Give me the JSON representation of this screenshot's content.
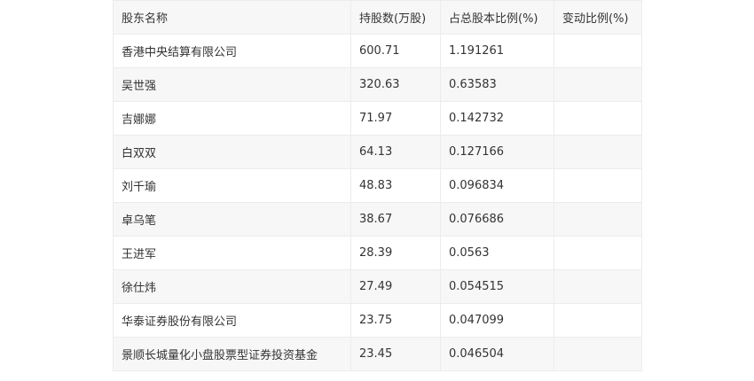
{
  "table": {
    "headers": [
      "股东名称",
      "持股数(万股)",
      "占总股本比例(%)",
      "变动比例(%)"
    ],
    "rows": [
      [
        "香港中央结算有限公司",
        "600.71",
        "1.191261",
        ""
      ],
      [
        "吴世强",
        "320.63",
        "0.63583",
        ""
      ],
      [
        "吉娜娜",
        "71.97",
        "0.142732",
        ""
      ],
      [
        "白双双",
        "64.13",
        "0.127166",
        ""
      ],
      [
        "刘千瑜",
        "48.83",
        "0.096834",
        ""
      ],
      [
        "卓乌笔",
        "38.67",
        "0.076686",
        ""
      ],
      [
        "王进军",
        "28.39",
        "0.0563",
        ""
      ],
      [
        "徐仕炜",
        "27.49",
        "0.054515",
        ""
      ],
      [
        "华泰证券股份有限公司",
        "23.75",
        "0.047099",
        ""
      ],
      [
        "景顺长城量化小盘股票型证券投资基金",
        "23.45",
        "0.046504",
        ""
      ]
    ]
  }
}
